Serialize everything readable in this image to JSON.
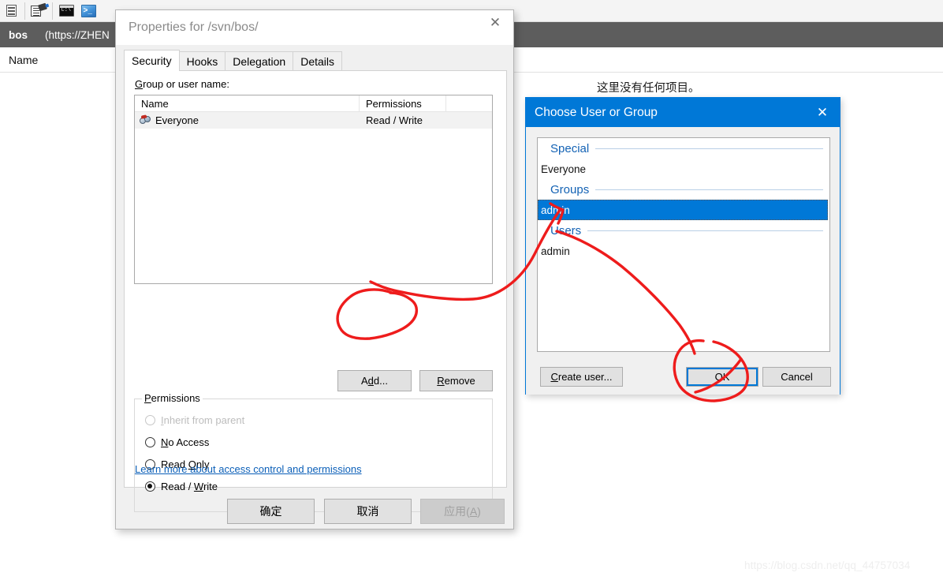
{
  "app": {
    "toolbar_icons": [
      "repo-properties-icon",
      "hook-script-icon",
      "command-prompt-icon",
      "powershell-icon"
    ],
    "repo_bar": {
      "name": "bos",
      "url": "(https://ZHEN"
    },
    "list_columns": [
      "Name"
    ],
    "empty_message": "这里没有任何项目。",
    "watermark": "https://blog.csdn.net/qq_44757034"
  },
  "properties_dialog": {
    "title": "Properties for /svn/bos/",
    "close_glyph": "✕",
    "tabs": [
      {
        "label": "Security",
        "active": true
      },
      {
        "label": "Hooks",
        "active": false
      },
      {
        "label": "Delegation",
        "active": false
      },
      {
        "label": "Details",
        "active": false
      }
    ],
    "group_user_label": "Group or user name:",
    "acl_table": {
      "columns": [
        "Name",
        "Permissions",
        ""
      ],
      "rows": [
        {
          "name": "Everyone",
          "permissions": "Read / Write",
          "icon": "group-icon",
          "selected": true
        }
      ]
    },
    "buttons": {
      "add": "Add...",
      "remove": "Remove"
    },
    "permissions_group": {
      "label": "Permissions",
      "options": [
        {
          "label": "Inherit from parent",
          "checked": false,
          "disabled": true
        },
        {
          "label": "No Access",
          "checked": false,
          "disabled": false
        },
        {
          "label": "Read Only",
          "checked": false,
          "disabled": false
        },
        {
          "label": "Read / Write",
          "checked": true,
          "disabled": false
        }
      ]
    },
    "learn_more_link": "Learn more about access control and permissions",
    "footer_buttons": {
      "ok": "确定",
      "cancel": "取消",
      "apply": "应用(A)",
      "apply_disabled": true
    }
  },
  "choose_dialog": {
    "title": "Choose User or Group",
    "close_glyph": "✕",
    "accent_color": "#0078d7",
    "list": [
      {
        "type": "category",
        "label": "Special"
      },
      {
        "type": "item",
        "label": "Everyone",
        "selected": false
      },
      {
        "type": "category",
        "label": "Groups"
      },
      {
        "type": "item",
        "label": "admin",
        "selected": true
      },
      {
        "type": "category",
        "label": "Users"
      },
      {
        "type": "item",
        "label": "admin",
        "selected": false
      }
    ],
    "buttons": {
      "create_user": "Create user...",
      "ok": "OK",
      "cancel": "Cancel"
    }
  },
  "annotations": {
    "color": "#ee1c1c",
    "marks": [
      "circle-around-add-button",
      "circle-around-ok-button",
      "arrow-admin-to-add",
      "arrow-users-to-ok"
    ]
  }
}
